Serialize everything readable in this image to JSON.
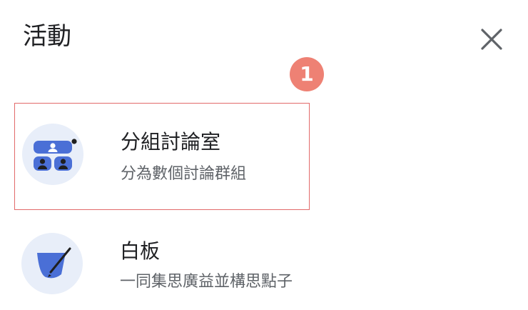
{
  "header": {
    "title": "活動",
    "close_icon": "close-icon"
  },
  "annotation": {
    "badge_number": "1",
    "color": "#ee8174"
  },
  "activities": [
    {
      "title": "分組討論室",
      "description": "分為數個討論群組",
      "icon": "breakout-rooms-icon",
      "highlighted": true,
      "highlight_color": "#e26a6a"
    },
    {
      "title": "白板",
      "description": "一同集思廣益並構思點子",
      "icon": "whiteboard-icon",
      "highlighted": false
    }
  ],
  "colors": {
    "icon_bg": "#e8eef9",
    "icon_blue": "#4a6fd6"
  }
}
